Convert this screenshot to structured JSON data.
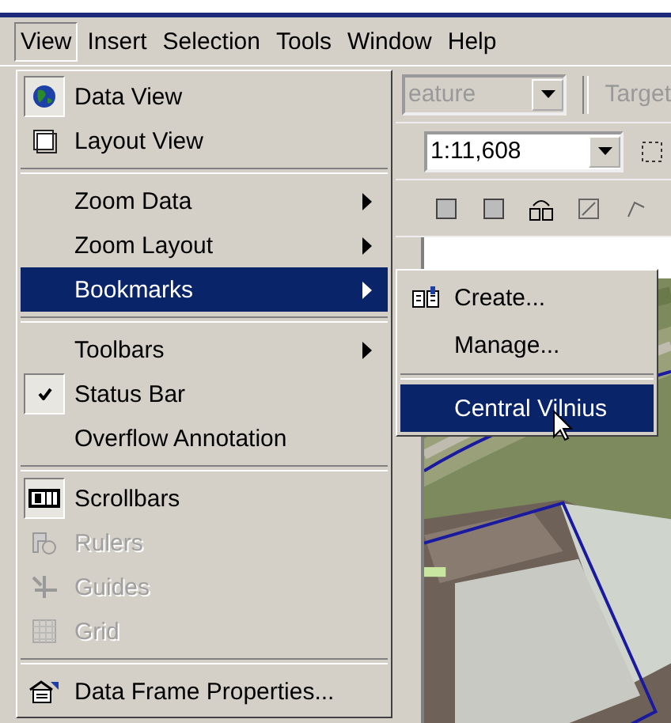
{
  "menubar": [
    {
      "label": "View",
      "selected": true
    },
    {
      "label": "Insert",
      "selected": false
    },
    {
      "label": "Selection",
      "selected": false
    },
    {
      "label": "Tools",
      "selected": false
    },
    {
      "label": "Window",
      "selected": false
    },
    {
      "label": "Help",
      "selected": false
    }
  ],
  "toolbar": {
    "layer_combo": "eature",
    "target_label": "Target",
    "scale_combo": "1:11,608"
  },
  "menu": [
    {
      "kind": "item",
      "label": "Data View",
      "checked": true,
      "disabled": false,
      "selected": false,
      "submenu": false
    },
    {
      "kind": "item",
      "label": "Layout View",
      "checked": false,
      "disabled": false,
      "selected": false,
      "submenu": false
    },
    {
      "kind": "separator"
    },
    {
      "kind": "item",
      "label": "Zoom Data",
      "checked": false,
      "disabled": false,
      "selected": false,
      "submenu": true
    },
    {
      "kind": "item",
      "label": "Zoom Layout",
      "checked": false,
      "disabled": false,
      "selected": false,
      "submenu": true
    },
    {
      "kind": "item",
      "label": "Bookmarks",
      "checked": false,
      "disabled": false,
      "selected": true,
      "submenu": true
    },
    {
      "kind": "separator"
    },
    {
      "kind": "item",
      "label": "Toolbars",
      "checked": false,
      "disabled": false,
      "selected": false,
      "submenu": true
    },
    {
      "kind": "item",
      "label": "Status Bar",
      "checked": true,
      "disabled": false,
      "selected": false,
      "submenu": false
    },
    {
      "kind": "item",
      "label": "Overflow Annotation",
      "checked": false,
      "disabled": false,
      "selected": false,
      "submenu": false
    },
    {
      "kind": "separator"
    },
    {
      "kind": "item",
      "label": "Scrollbars",
      "checked": true,
      "disabled": false,
      "selected": false,
      "submenu": false
    },
    {
      "kind": "item",
      "label": "Rulers",
      "checked": false,
      "disabled": true,
      "selected": false,
      "submenu": false
    },
    {
      "kind": "item",
      "label": "Guides",
      "checked": false,
      "disabled": true,
      "selected": false,
      "submenu": false
    },
    {
      "kind": "item",
      "label": "Grid",
      "checked": false,
      "disabled": true,
      "selected": false,
      "submenu": false
    },
    {
      "kind": "separator"
    },
    {
      "kind": "item",
      "label": "Data Frame Properties...",
      "checked": false,
      "disabled": false,
      "selected": false,
      "submenu": false
    }
  ],
  "bookmarks_submenu": [
    {
      "kind": "item",
      "label": "Create...",
      "selected": false
    },
    {
      "kind": "item",
      "label": "Manage...",
      "selected": false
    },
    {
      "kind": "separator"
    },
    {
      "kind": "item",
      "label": "Central Vilnius",
      "selected": true
    }
  ]
}
